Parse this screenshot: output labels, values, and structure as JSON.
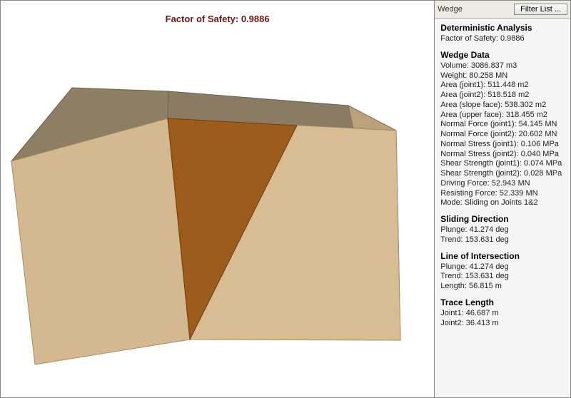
{
  "viewport": {
    "fos_title": "Factor of Safety: 0.9886"
  },
  "side_top": {
    "label": "Wedge",
    "filter_button": "Filter List ..."
  },
  "sections": {
    "deterministic": {
      "title": "Deterministic Analysis",
      "fos": "Factor of Safety: 0.9886"
    },
    "wedge_data": {
      "title": "Wedge Data",
      "volume": "Volume: 3086.837 m3",
      "weight": "Weight: 80.258 MN",
      "area_j1": "Area (joint1): 511.448 m2",
      "area_j2": "Area (joint2): 518.518 m2",
      "area_slope": "Area (slope face): 538.302 m2",
      "area_upper": "Area (upper face): 318.455 m2",
      "nforce_j1": "Normal Force (joint1): 54.145 MN",
      "nforce_j2": "Normal Force (joint2): 20.602 MN",
      "nstress_j1": "Normal Stress (joint1): 0.106 MPa",
      "nstress_j2": "Normal Stress (joint2): 0.040 MPa",
      "sstrength_j1": "Shear Strength (joint1): 0.074 MPa",
      "sstrength_j2": "Shear Strength (joint2): 0.028 MPa",
      "driving": "Driving Force: 52.943 MN",
      "resisting": "Resisting Force: 52.339 MN",
      "mode": "Mode: Sliding on Joints 1&2"
    },
    "sliding_direction": {
      "title": "Sliding Direction",
      "plunge": "Plunge: 41.274 deg",
      "trend": "Trend: 153.631 deg"
    },
    "line_intersection": {
      "title": "Line of Intersection",
      "plunge": "Plunge: 41.274 deg",
      "trend": "Trend: 153.631 deg",
      "length": "Length: 56.815 m"
    },
    "trace_length": {
      "title": "Trace Length",
      "j1": "Joint1: 46.687 m",
      "j2": "Joint2: 36.413 m"
    }
  }
}
